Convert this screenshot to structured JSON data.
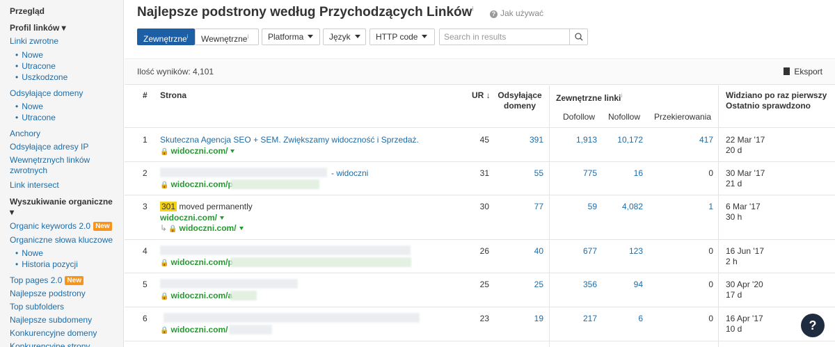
{
  "sidebar": {
    "overview": "Przegląd",
    "backlink_profile": "Profil linków ▾",
    "backlinks": "Linki zwrotne",
    "backlinks_new": "Nowe",
    "backlinks_lost": "Utracone",
    "backlinks_broken": "Uszkodzone",
    "ref_domains": "Odsyłające domeny",
    "ref_domains_new": "Nowe",
    "ref_domains_lost": "Utracone",
    "anchors": "Anchory",
    "ref_ips": "Odsyłające adresy IP",
    "internal_backlinks_1": "Wewnętrznych linków",
    "internal_backlinks_2": "zwrotnych",
    "link_intersect": "Link intersect",
    "organic_search": "Wyszukiwanie organiczne",
    "organic_search_caret": "▾",
    "organic_keywords_20": "Organic keywords 2.0",
    "new_badge": "New",
    "organic_keywords": "Organiczne słowa kluczowe",
    "organic_new": "Nowe",
    "position_history": "Historia pozycji",
    "top_pages_20": "Top pages 2.0",
    "top_pages": "Najlepsze podstrony",
    "top_subfolders": "Top subfolders",
    "top_subdomains": "Najlepsze subdomeny",
    "competing_domains": "Konkurencyjne domeny",
    "competing_pages": "Konkurencyjne strony"
  },
  "header": {
    "title": "Najlepsze podstrony według Przychodzących Linków",
    "title_sup": "i",
    "help_icon": "?",
    "help_text": "Jak używać"
  },
  "filters": {
    "external": "Zewnętrzne",
    "external_sup": "i",
    "internal": "Wewnętrzne",
    "internal_sup": "i",
    "platform": "Platforma",
    "language": "Język",
    "http_code": "HTTP code",
    "search_placeholder": "Search in results"
  },
  "results": {
    "count": "Ilość wyników: 4,101",
    "export": "Eksport"
  },
  "table": {
    "col_num": "#",
    "col_page": "Strona",
    "col_ur": "UR",
    "col_ur_arrow": "↓",
    "col_refdomains_1": "Odsyłające",
    "col_refdomains_2": "domeny",
    "col_extlinks": "Zewnętrzne linki",
    "col_extlinks_sup": "i",
    "col_dofollow": "Dofollow",
    "col_nofollow": "Nofollow",
    "col_redirect": "Przekierowania",
    "col_seen_1": "Widziano po raz pierwszy",
    "col_seen_2": "Ostatnio sprawdzono",
    "rows": [
      {
        "n": "1",
        "title": "Skuteczna Agencja SEO + SEM. Zwiększamy widoczność i Sprzedaż.",
        "url": "widoczni.com/",
        "ur": "45",
        "rd": "391",
        "dofollow": "1,913",
        "nofollow": "10,172",
        "redirect": "417",
        "first": "22 Mar '17",
        "last": "20 d"
      },
      {
        "n": "2",
        "title": "- widoczni",
        "url": "widoczni.com/p",
        "ur": "31",
        "rd": "55",
        "dofollow": "775",
        "nofollow": "16",
        "redirect": "0",
        "first": "30 Mar '17",
        "last": "21 d"
      },
      {
        "n": "3",
        "code": "301",
        "title": "moved permanently",
        "url": "widoczni.com/",
        "redirect_url": "widoczni.com/",
        "ur": "30",
        "rd": "77",
        "dofollow": "59",
        "nofollow": "4,082",
        "redirect": "1",
        "first": "6 Mar '17",
        "last": "30 h"
      },
      {
        "n": "4",
        "url": "widoczni.com/p",
        "ur": "26",
        "rd": "40",
        "dofollow": "677",
        "nofollow": "123",
        "redirect": "0",
        "first": "16 Jun '17",
        "last": "2 h"
      },
      {
        "n": "5",
        "url": "widoczni.com/a",
        "ur": "25",
        "rd": "25",
        "dofollow": "356",
        "nofollow": "94",
        "redirect": "0",
        "first": "30 Apr '20",
        "last": "17 d"
      },
      {
        "n": "6",
        "url": "widoczni.com/",
        "ur": "23",
        "rd": "19",
        "dofollow": "217",
        "nofollow": "6",
        "redirect": "0",
        "first": "16 Apr '17",
        "last": "10 d"
      }
    ]
  },
  "help_button": "?"
}
